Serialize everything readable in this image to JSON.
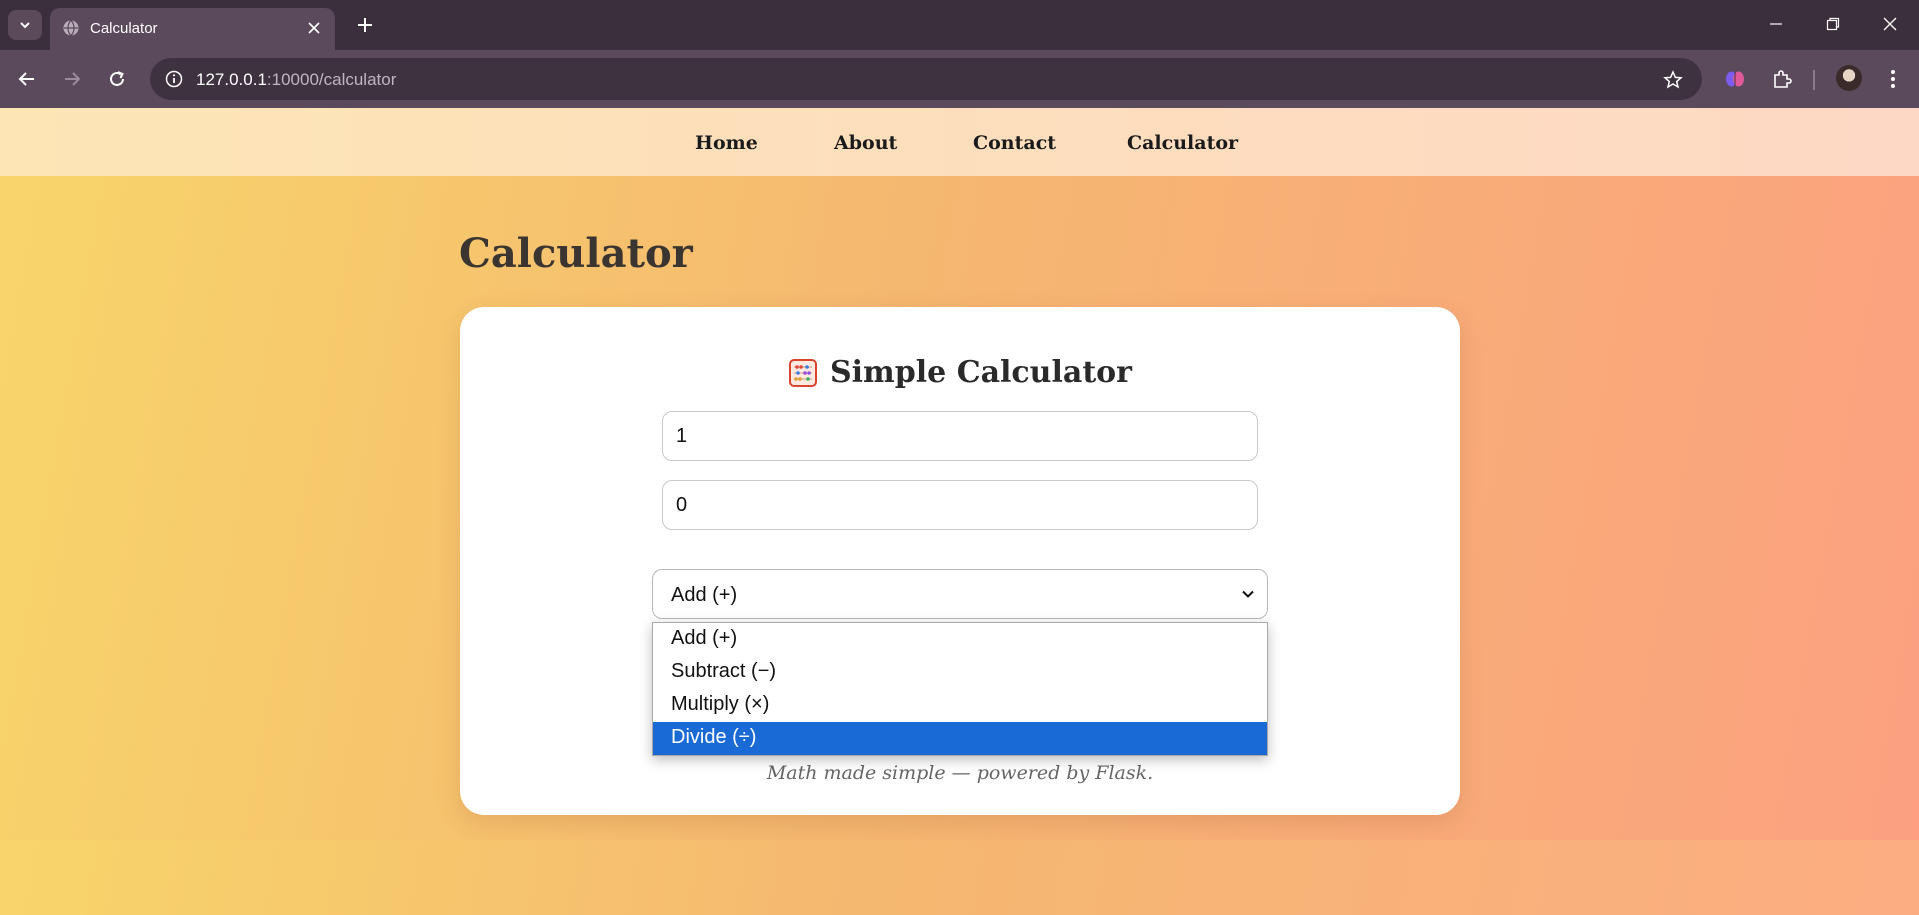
{
  "browser": {
    "tab_title": "Calculator",
    "url_host": "127.0.0.1",
    "url_rest": ":10000/calculator"
  },
  "nav": {
    "items": [
      "Home",
      "About",
      "Contact",
      "Calculator"
    ]
  },
  "page": {
    "heading": "Calculator"
  },
  "calculator": {
    "title": "Simple Calculator",
    "first_number": "1",
    "second_number": "0",
    "selected_operation": "Add (+)",
    "operations": [
      "Add (+)",
      "Subtract (−)",
      "Multiply (×)",
      "Divide (÷)"
    ],
    "highlighted_option": "Divide (÷)",
    "footnote": "Math made simple — powered by Flask."
  },
  "colors": {
    "highlight": "#1a6ad6",
    "gradient_start": "#f8d56a",
    "gradient_end": "#fca080"
  }
}
